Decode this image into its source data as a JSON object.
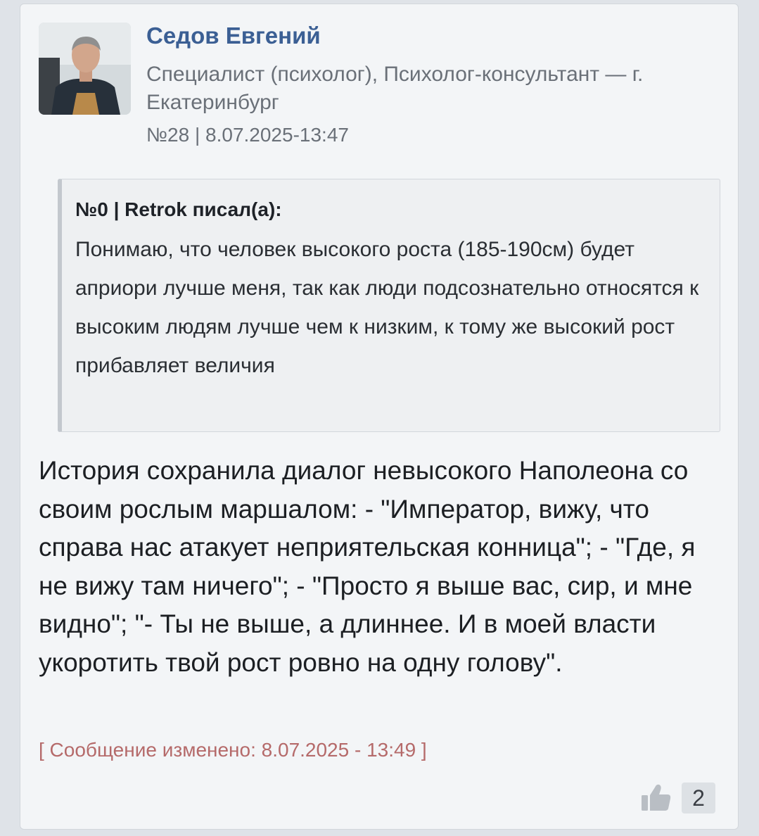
{
  "post": {
    "author_name": "Седов Евгений",
    "author_role": "Специалист (психолог), Психолог-консультант — г. Екатеринбург",
    "post_meta": "№28 | 8.07.2025-13:47",
    "quote": {
      "header": "№0 | Retrok писал(а):",
      "text": "Понимаю, что человек высокого роста (185-190см) будет априори лучше меня, так как люди подсознательно относятся к высоким людям лучше чем к низким, к тому же высокий рост прибавляет величия"
    },
    "message": "История сохранила диалог невысокого Наполеона со своим рослым маршалом: - \"Император, вижу, что справа нас атакует неприятельская конница\"; - \"Где, я не вижу там ничего\"; - \"Просто я выше вас, сир, и мне видно\"; \"- Ты не выше, а длиннее. И в моей власти укоротить твой рост ровно на одну голову\".",
    "edited_note": "[ Сообщение изменено: 8.07.2025 - 13:49 ]",
    "likes": "2"
  },
  "icons": {
    "avatar": "author-avatar-photo",
    "like": "thumbs-up-icon"
  },
  "colors": {
    "author_name": "#3b5f94",
    "edited_note": "#b56a6a",
    "card_background": "#f3f5f7",
    "quote_background": "#eef0f2"
  }
}
